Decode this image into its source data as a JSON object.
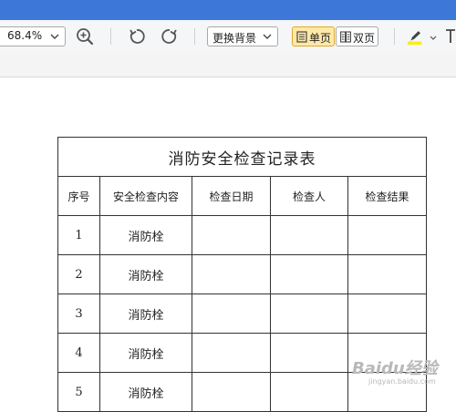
{
  "toolbar": {
    "zoom_value": "68.4%",
    "background_label": "更换背景",
    "single_page_label": "单页",
    "double_page_label": "双页",
    "highlight_color": "#f7ef1a"
  },
  "document": {
    "table_title": "消防安全检查记录表",
    "headers": [
      "序号",
      "安全检查内容",
      "检查日期",
      "检查人",
      "检查结果"
    ],
    "rows": [
      [
        "1",
        "消防栓",
        "",
        "",
        ""
      ],
      [
        "2",
        "消防栓",
        "",
        "",
        ""
      ],
      [
        "3",
        "消防栓",
        "",
        "",
        ""
      ],
      [
        "4",
        "消防栓",
        "",
        "",
        ""
      ],
      [
        "5",
        "消防栓",
        "",
        "",
        ""
      ]
    ]
  },
  "watermark": {
    "brand": "Baidu经验",
    "sub": "jingyan.baidu.com"
  }
}
